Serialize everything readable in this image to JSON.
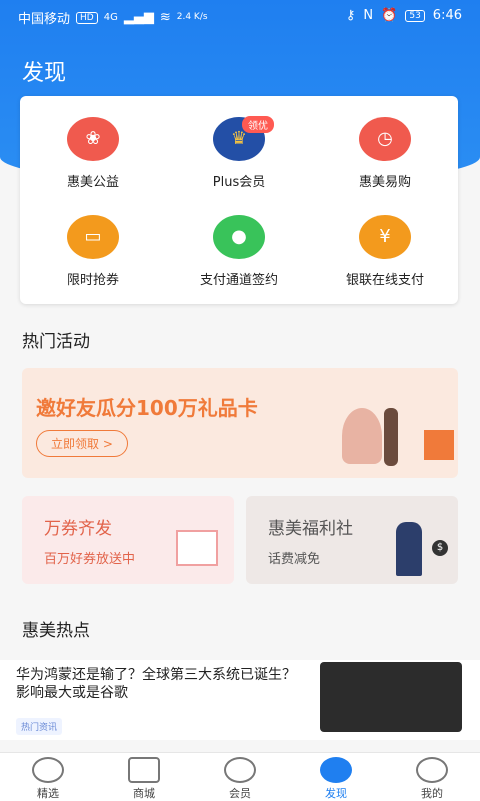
{
  "status": {
    "carrier": "中国移动",
    "hd": "HD",
    "net": "4G",
    "speed": "2.4 K/s",
    "nfc": "N",
    "battery": "53",
    "time": "6:46"
  },
  "page": {
    "title": "发现"
  },
  "services": [
    {
      "label": "惠美公益",
      "color": "#f05a4e"
    },
    {
      "label": "Plus会员",
      "color": "#234fa6",
      "badge": "领优"
    },
    {
      "label": "惠美易购",
      "color": "#f05a4e"
    },
    {
      "label": "限时抢券",
      "color": "#f39a1d"
    },
    {
      "label": "支付通道签约",
      "color": "#39c35a"
    },
    {
      "label": "银联在线支付",
      "color": "#f39a1d"
    }
  ],
  "sections": {
    "hot": "热门活动",
    "points": "惠美热点"
  },
  "banner": {
    "title": "邀好友瓜分100万礼品卡",
    "button": "立即领取 >"
  },
  "cards": [
    {
      "title": "万券齐发",
      "subtitle": "百万好券放送中"
    },
    {
      "title": "惠美福利社",
      "subtitle": "话费减免"
    }
  ],
  "news": {
    "text": "华为鸿蒙还是输了？全球第三大系统已诞生？影响最大或是谷歌",
    "tag": "热门资讯"
  },
  "tabs": [
    "精选",
    "商城",
    "会员",
    "发现",
    "我的"
  ]
}
